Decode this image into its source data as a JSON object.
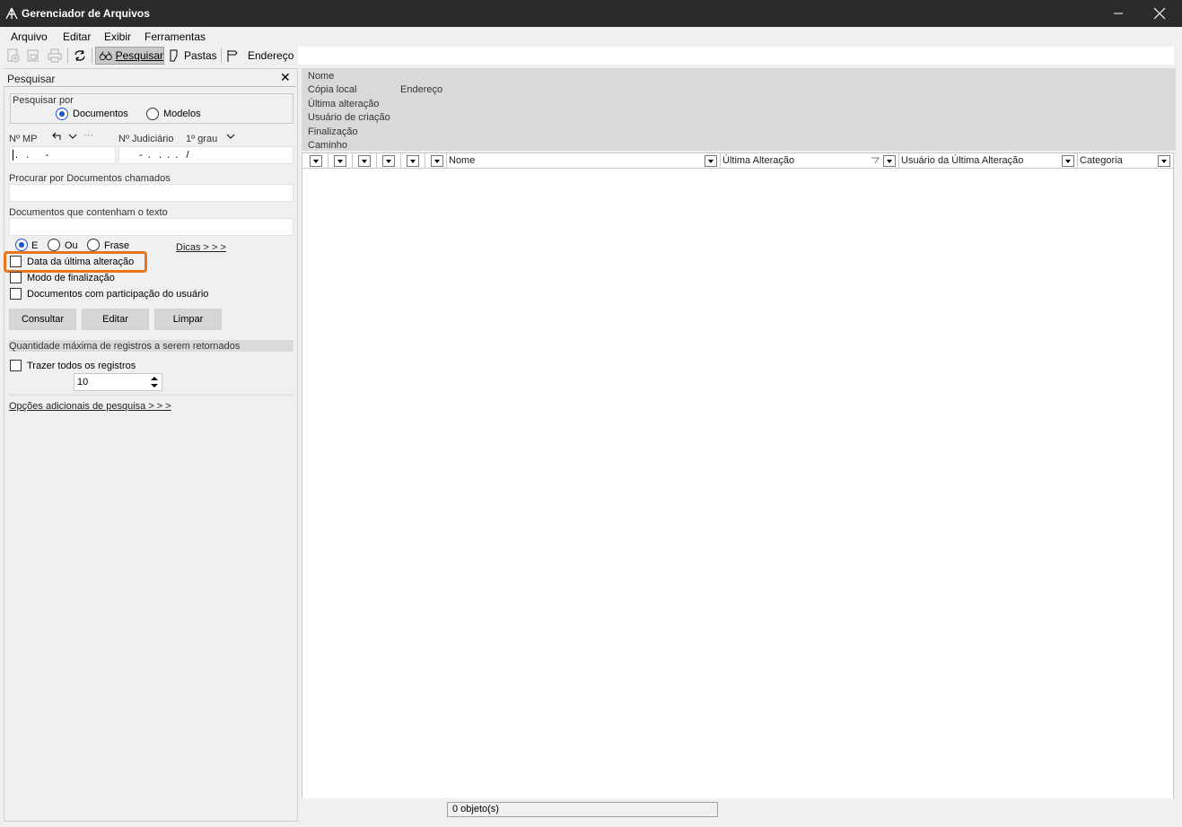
{
  "window": {
    "title": "Gerenciador de Arquivos"
  },
  "menu": [
    {
      "label": "Arquivo"
    },
    {
      "label": "Editar"
    },
    {
      "label": "Exibir"
    },
    {
      "label": "Ferramentas"
    }
  ],
  "toolbar": {
    "search_label": "Pesquisar",
    "folders_label": "Pastas",
    "address_label": "Endereço"
  },
  "search_panel": {
    "title": "Pesquisar",
    "search_by_label": "Pesquisar por",
    "option_documents": "Documentos",
    "option_models": "Modelos",
    "selected": "Documentos",
    "mp_label": "Nº MP",
    "mp_value": ".   .      -",
    "judicial_label": "Nº Judiciário",
    "degree_label": "1º grau",
    "judicial_value": "-  .   .  .  .   /",
    "named_label": "Procurar por Documentos chamados",
    "named_value": "",
    "text_label": "Documentos que contenham o texto",
    "text_value": "",
    "logic_and": "E",
    "logic_or": "Ou",
    "logic_phrase": "Frase",
    "tips_link": "Dicas > > >",
    "check_last_change": "Data da última alteração",
    "check_finalization": "Modo de finalização",
    "check_participation": "Documentos com participação do usuário",
    "btn_query": "Consultar",
    "btn_edit": "Editar",
    "btn_clear": "Limpar",
    "max_records_label": "Quantidade máxima de registros a serem retornados",
    "check_all_records": "Trazer todos os registros",
    "max_records_value": "10",
    "more_options_link": "Opções adicionais de pesquisa > > >"
  },
  "details": {
    "name": "Nome",
    "local_copy": "Cópia local",
    "address": "Endereço",
    "last_change": "Última alteração",
    "creator": "Usuário de criação",
    "finalization": "Finalização",
    "path": "Caminho"
  },
  "grid": {
    "columns": [
      "Nome",
      "Última Alteração",
      "Usuário da Última Alteração",
      "Categoria"
    ]
  },
  "status": {
    "count": "0 objeto(s)"
  },
  "colors": {
    "titlebar": "#2b2b2b",
    "highlight": "#e5761e",
    "radio_accent": "#1a56c8"
  }
}
